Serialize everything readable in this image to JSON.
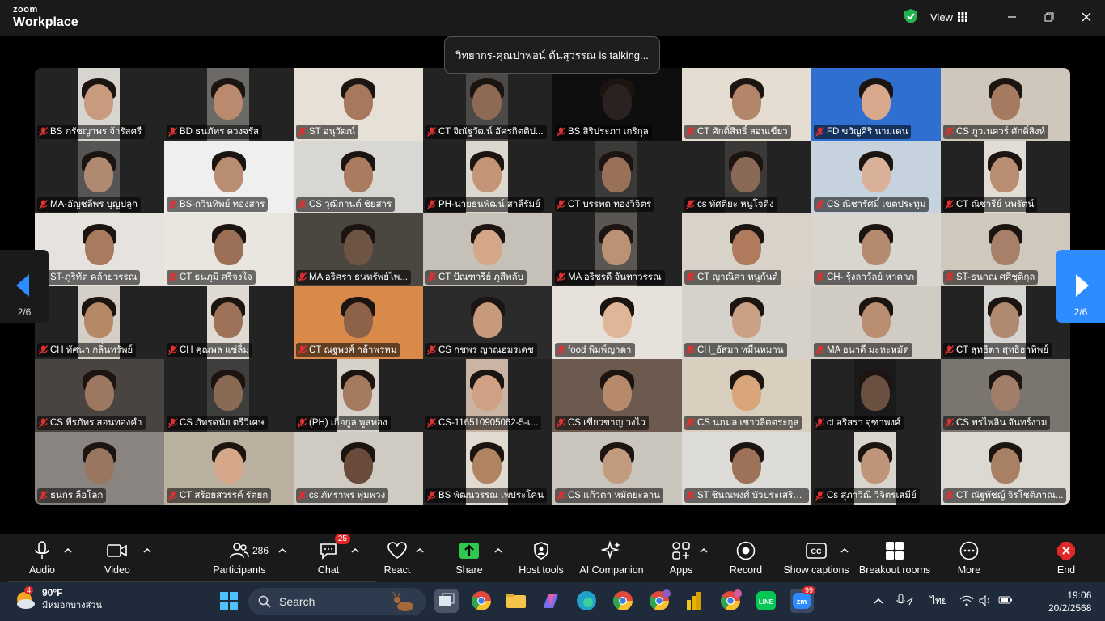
{
  "titlebar": {
    "brand_top": "zoom",
    "brand_bottom": "Workplace",
    "view_label": "View"
  },
  "talking_banner": "วิทยากร-คุณปาพอน์ ต้นสุวรรณ is talking...",
  "pager": {
    "prev_label": "2/6",
    "next_label": "2/6"
  },
  "participants": [
    {
      "name": "BS ภรัชญาพร จ้ารัสศรี",
      "bg": "#d8d4d0",
      "face": "#c89a7e",
      "layout": "narrow"
    },
    {
      "name": "BD ธนภัทร ดวงจรัส",
      "bg": "#6b6a66",
      "face": "#b98a6e",
      "layout": "narrow"
    },
    {
      "name": "ST อนุวัฒน์",
      "bg": "#e7e0d6",
      "face": "#a7785d",
      "layout": "full"
    },
    {
      "name": "CT จิณัฐวัฒน์ อัครกิตติป...",
      "bg": "#4c4a48",
      "face": "#8e6a55",
      "layout": "narrow"
    },
    {
      "name": "BS สิริประภา เกริกุล",
      "bg": "#0e0e0e",
      "face": "#2a2220",
      "layout": "full"
    },
    {
      "name": "CT ศักดิ์สิทธิ์ สอนเขียว",
      "bg": "#e5ddd2",
      "face": "#b3856a",
      "layout": "full"
    },
    {
      "name": "FD ขวัญศิริ นามเดน",
      "bg": "#2f6fd0",
      "face": "#d8a98d",
      "layout": "full"
    },
    {
      "name": "CS ภูวเนศวร์ ศักดิ์สิงห์",
      "bg": "#cfc7bb",
      "face": "#a57a60",
      "layout": "full"
    },
    {
      "name": "MA-อัญชลีพร บุญปลูก",
      "bg": "#555",
      "face": "#b08a70",
      "layout": "narrow"
    },
    {
      "name": "BS-กวินทิพย์ ทองสาร",
      "bg": "#efefef",
      "face": "#b88d70",
      "layout": "full"
    },
    {
      "name": "CS วุฒิกานต์ ชัยสาร",
      "bg": "#d9d7d4",
      "face": "#a97c60",
      "layout": "full"
    },
    {
      "name": "PH-นายธนพัฒน์ สาลีรัมย์",
      "bg": "#dcd8d0",
      "face": "#c49476",
      "layout": "narrow"
    },
    {
      "name": "CT บรรพต ทองวิจิตร",
      "bg": "#3a3a38",
      "face": "#9a7058",
      "layout": "narrow"
    },
    {
      "name": "cs ทัศติยะ หนูโจดิง",
      "bg": "#3b3838",
      "face": "#8a6a56",
      "layout": "narrow"
    },
    {
      "name": "CS ณิชารัศมิ์ เขตประทุม",
      "bg": "#c7d2df",
      "face": "#d9b098",
      "layout": "full"
    },
    {
      "name": "CT ณิชารีย์ นพรัตน์",
      "bg": "#e2ddd4",
      "face": "#b88d72",
      "layout": "narrow"
    },
    {
      "name": "ST-ภูริทัต คล้ายวรรณ",
      "bg": "#e6e3de",
      "face": "#a87b5f",
      "layout": "full"
    },
    {
      "name": "CT ธนภูมิ ศรีจงใจ",
      "bg": "#e9e6e0",
      "face": "#9c7056",
      "layout": "full"
    },
    {
      "name": "MA อริศรา ธนทรัพย์ไพ...",
      "bg": "#4a4640",
      "face": "#6d5444",
      "layout": "full"
    },
    {
      "name": "CT ปัณฑารีย์ ภูสีพลับ",
      "bg": "#c6c1b8",
      "face": "#d4a788",
      "layout": "full"
    },
    {
      "name": "MA อริชรดี จันทาวรรณ",
      "bg": "#5a5752",
      "face": "#bd9175",
      "layout": "narrow"
    },
    {
      "name": "CT ญาณิศา หนูกันต์",
      "bg": "#d8d2c8",
      "face": "#b07a5c",
      "layout": "full"
    },
    {
      "name": "CH- รุ้งลาวัลย์ หาคาภ",
      "bg": "#d9d6d0",
      "face": "#b58b70",
      "layout": "full"
    },
    {
      "name": "ST-ธนกณ ศศิชุติกุล",
      "bg": "#cfc8bc",
      "face": "#a8806a",
      "layout": "full"
    },
    {
      "name": "CH ทัศนา กลิ่นทรัพย์",
      "bg": "#d4cfc6",
      "face": "#b58866",
      "layout": "narrow"
    },
    {
      "name": "CH คุณพล แซ่ลิ้ม",
      "bg": "#dedad2",
      "face": "#9d7258",
      "layout": "narrow"
    },
    {
      "name": "CT ณฐพงศ์ กล้าพรหม",
      "bg": "#d98a4a",
      "face": "#8e6248",
      "layout": "full"
    },
    {
      "name": "CS กชพร ญาณอมรเดช",
      "bg": "#2b2b2b",
      "face": "#c79a7c",
      "layout": "full"
    },
    {
      "name": "food พิมพ์ญาดา",
      "bg": "#e6e1da",
      "face": "#e0b698",
      "layout": "full"
    },
    {
      "name": "CH_อัสมา หมีนหมาน",
      "bg": "#d5d1cb",
      "face": "#caa184",
      "layout": "full"
    },
    {
      "name": "MA อนาดี มะหะหมัด",
      "bg": "#d0cbc3",
      "face": "#ba8e70",
      "layout": "full"
    },
    {
      "name": "CT สุทธิตา สุทธิธาทิพย์",
      "bg": "#d7d5d2",
      "face": "#b08a70",
      "layout": "narrow"
    },
    {
      "name": "CS พีรภัทร สอนทองคำ",
      "bg": "#4a4440",
      "face": "#9c7860",
      "layout": "full"
    },
    {
      "name": "CS ภัทรดนัย ตรีวิเศษ",
      "bg": "#3e3e3c",
      "face": "#8a6a54",
      "layout": "narrow"
    },
    {
      "name": "(PH) เกื้อกูล พูลทอง",
      "bg": "#d6d2ca",
      "face": "#a57a5e",
      "layout": "narrow"
    },
    {
      "name": "CS-116510905062-5-เ...",
      "bg": "#c9b4a6",
      "face": "#d0a084",
      "layout": "narrow"
    },
    {
      "name": "CS เขียวขาญ วงไว",
      "bg": "#6c5a4e",
      "face": "#b88a6c",
      "layout": "full"
    },
    {
      "name": "CS นภมล เชาวลิตตระกูล",
      "bg": "#d8cfbf",
      "face": "#d9a57a",
      "layout": "full"
    },
    {
      "name": "ct อริสรา จุฑาพงศ์",
      "bg": "#1a1a1a",
      "face": "#6a5040",
      "layout": "narrow"
    },
    {
      "name": "CS พรไพลิน จันทร์งาม",
      "bg": "#7a756e",
      "face": "#a07e68",
      "layout": "full"
    },
    {
      "name": "ธนกร ลือโลก",
      "bg": "#8a8480",
      "face": "#9a7660",
      "layout": "full"
    },
    {
      "name": "CT สร้อยสวรรค์ รัตยก",
      "bg": "#b9b0a0",
      "face": "#d6a88a",
      "layout": "full"
    },
    {
      "name": "cs ภัทราพร พุ่มพวง",
      "bg": "#cfcac2",
      "face": "#6a4a3a",
      "layout": "full"
    },
    {
      "name": "BS พัฒนวรรณ เพประโคน",
      "bg": "#e0dad0",
      "face": "#b08460",
      "layout": "narrow"
    },
    {
      "name": "CS แก้วตา หมัดยะลาน",
      "bg": "#c9c4bc",
      "face": "#c29a7e",
      "layout": "full"
    },
    {
      "name": "ST ชินณพงศ์ บัวประเสริฐ...",
      "bg": "#dedcd8",
      "face": "#9e7258",
      "layout": "full"
    },
    {
      "name": "Cs สุภาวิณี วิจิตรเสมีย์",
      "bg": "#d8d4ce",
      "face": "#c09478",
      "layout": "narrow"
    },
    {
      "name": "CT ณัฐพัชญ์ จิรโชติภาณ...",
      "bg": "#dcd8d2",
      "face": "#a88064",
      "layout": "full"
    }
  ],
  "toolbar": {
    "audio": "Audio",
    "video": "Video",
    "participants": "Participants",
    "participants_count": "286",
    "chat": "Chat",
    "chat_badge": "25",
    "react": "React",
    "share": "Share",
    "host_tools": "Host tools",
    "ai_companion": "AI Companion",
    "apps": "Apps",
    "record": "Record",
    "captions": "Show captions",
    "breakout": "Breakout rooms",
    "more": "More",
    "end": "End",
    "colors": {
      "share_green": "#2dc84d",
      "end_red": "#e02828"
    }
  },
  "taskbar": {
    "weather_badge": "4",
    "temperature": "90°F",
    "weather_desc": "มีหมอกบางส่วน",
    "search_label": "Search",
    "zoom_badge": "99",
    "lang": "ไทย",
    "time": "19:06",
    "date": "20/2/2568"
  }
}
